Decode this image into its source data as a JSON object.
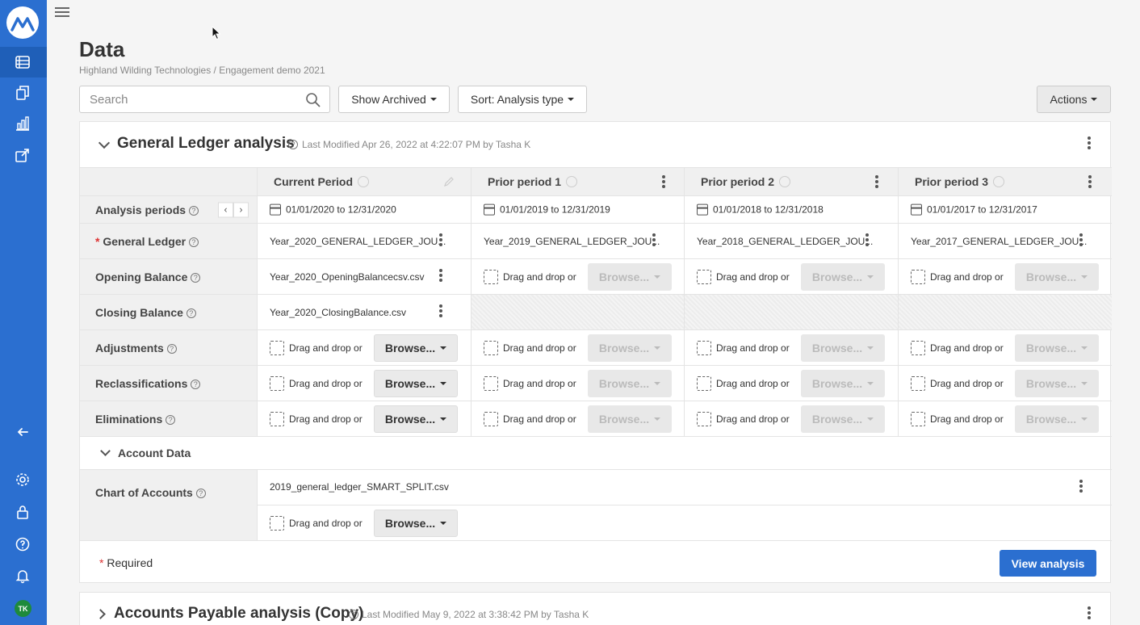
{
  "sidebar": {
    "items": [
      "data-icon",
      "files-icon",
      "chart-icon",
      "export-icon",
      "collapse-arrow-icon",
      "settings-icon",
      "lock-icon",
      "help-icon",
      "bell-icon"
    ],
    "avatar": "TK"
  },
  "page": {
    "title": "Data",
    "breadcrumb": "Highland Wilding Technologies / Engagement demo 2021"
  },
  "toolbar": {
    "search_placeholder": "Search",
    "show_archived": "Show Archived",
    "sort": "Sort: Analysis type",
    "actions": "Actions"
  },
  "card1": {
    "title": "General Ledger analysis",
    "meta": "Last Modified Apr 26, 2022 at 4:22:07 PM by Tasha K",
    "columns": [
      "Current Period",
      "Prior period 1",
      "Prior period 2",
      "Prior period 3"
    ],
    "rows": {
      "analysis_periods": {
        "label": "Analysis periods",
        "values": [
          "01/01/2020 to 12/31/2020",
          "01/01/2019 to 12/31/2019",
          "01/01/2018 to 12/31/2018",
          "01/01/2017 to 12/31/2017"
        ]
      },
      "general_ledger": {
        "required": "*",
        "label": "General Ledger",
        "values": [
          "Year_2020_GENERAL_LEDGER_JOU...",
          "Year_2019_GENERAL_LEDGER_JOU...",
          "Year_2018_GENERAL_LEDGER_JOU...",
          "Year_2017_GENERAL_LEDGER_JOU..."
        ]
      },
      "opening_balance": {
        "label": "Opening Balance",
        "value": "Year_2020_OpeningBalancecsv.csv"
      },
      "closing_balance": {
        "label": "Closing Balance",
        "value": "Year_2020_ClosingBalance.csv"
      },
      "adjustments": {
        "label": "Adjustments"
      },
      "reclassifications": {
        "label": "Reclassifications"
      },
      "eliminations": {
        "label": "Eliminations"
      }
    },
    "drag_text": "Drag and drop or",
    "browse_label": "Browse...",
    "account_data": {
      "title": "Account Data",
      "chart_of_accounts_label": "Chart of Accounts",
      "chart_of_accounts_file": "2019_general_ledger_SMART_SPLIT.csv"
    },
    "required_star": "*",
    "required_text": "Required",
    "view_analysis": "View analysis"
  },
  "card2": {
    "title": "Accounts Payable analysis (Copy)",
    "meta": "Last Modified May 9, 2022 at 3:38:42 PM by Tasha K"
  }
}
